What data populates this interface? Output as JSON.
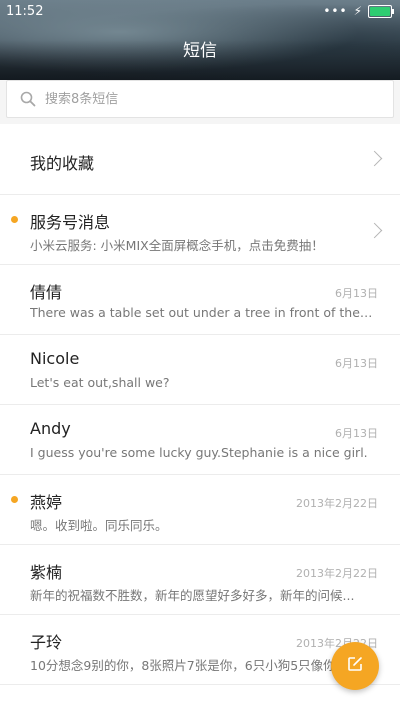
{
  "status_bar": {
    "time": "11:52",
    "signal_dots": "•••",
    "charging_icon": "bolt-icon",
    "battery_color": "#2ecc71"
  },
  "header": {
    "title": "短信"
  },
  "search": {
    "placeholder": "搜索8条短信",
    "icon": "search-icon"
  },
  "favorites": {
    "label": "我的收藏"
  },
  "messages": [
    {
      "name": "服务号消息",
      "date": "",
      "preview": "小米云服务: 小米MIX全面屏概念手机，点击免费抽！",
      "unread": true
    },
    {
      "name": "倩倩",
      "date": "6月13日",
      "preview": "There was a table set out under a tree in front of the ho...",
      "unread": false
    },
    {
      "name": "Nicole",
      "date": "6月13日",
      "preview": "Let's eat out,shall we?",
      "unread": false
    },
    {
      "name": "Andy",
      "date": "6月13日",
      "preview": "I guess you're some lucky guy.Stephanie is a nice girl.",
      "unread": false
    },
    {
      "name": "燕婷",
      "date": "2013年2月22日",
      "preview": "嗯。收到啦。同乐同乐。",
      "unread": true
    },
    {
      "name": "紫楠",
      "date": "2013年2月22日",
      "preview": "新年的祝福数不胜数，新年的愿望好多好多，新年的问候...",
      "unread": false
    },
    {
      "name": "子玲",
      "date": "2013年2月22日",
      "preview": "10分想念9别的你，8张照片7张是你，6只小狗5只像你...",
      "unread": false
    }
  ],
  "fab": {
    "icon": "compose-icon",
    "color": "#f5a623"
  },
  "colors": {
    "accent": "#f5a623",
    "unread_dot": "#f5a623"
  }
}
